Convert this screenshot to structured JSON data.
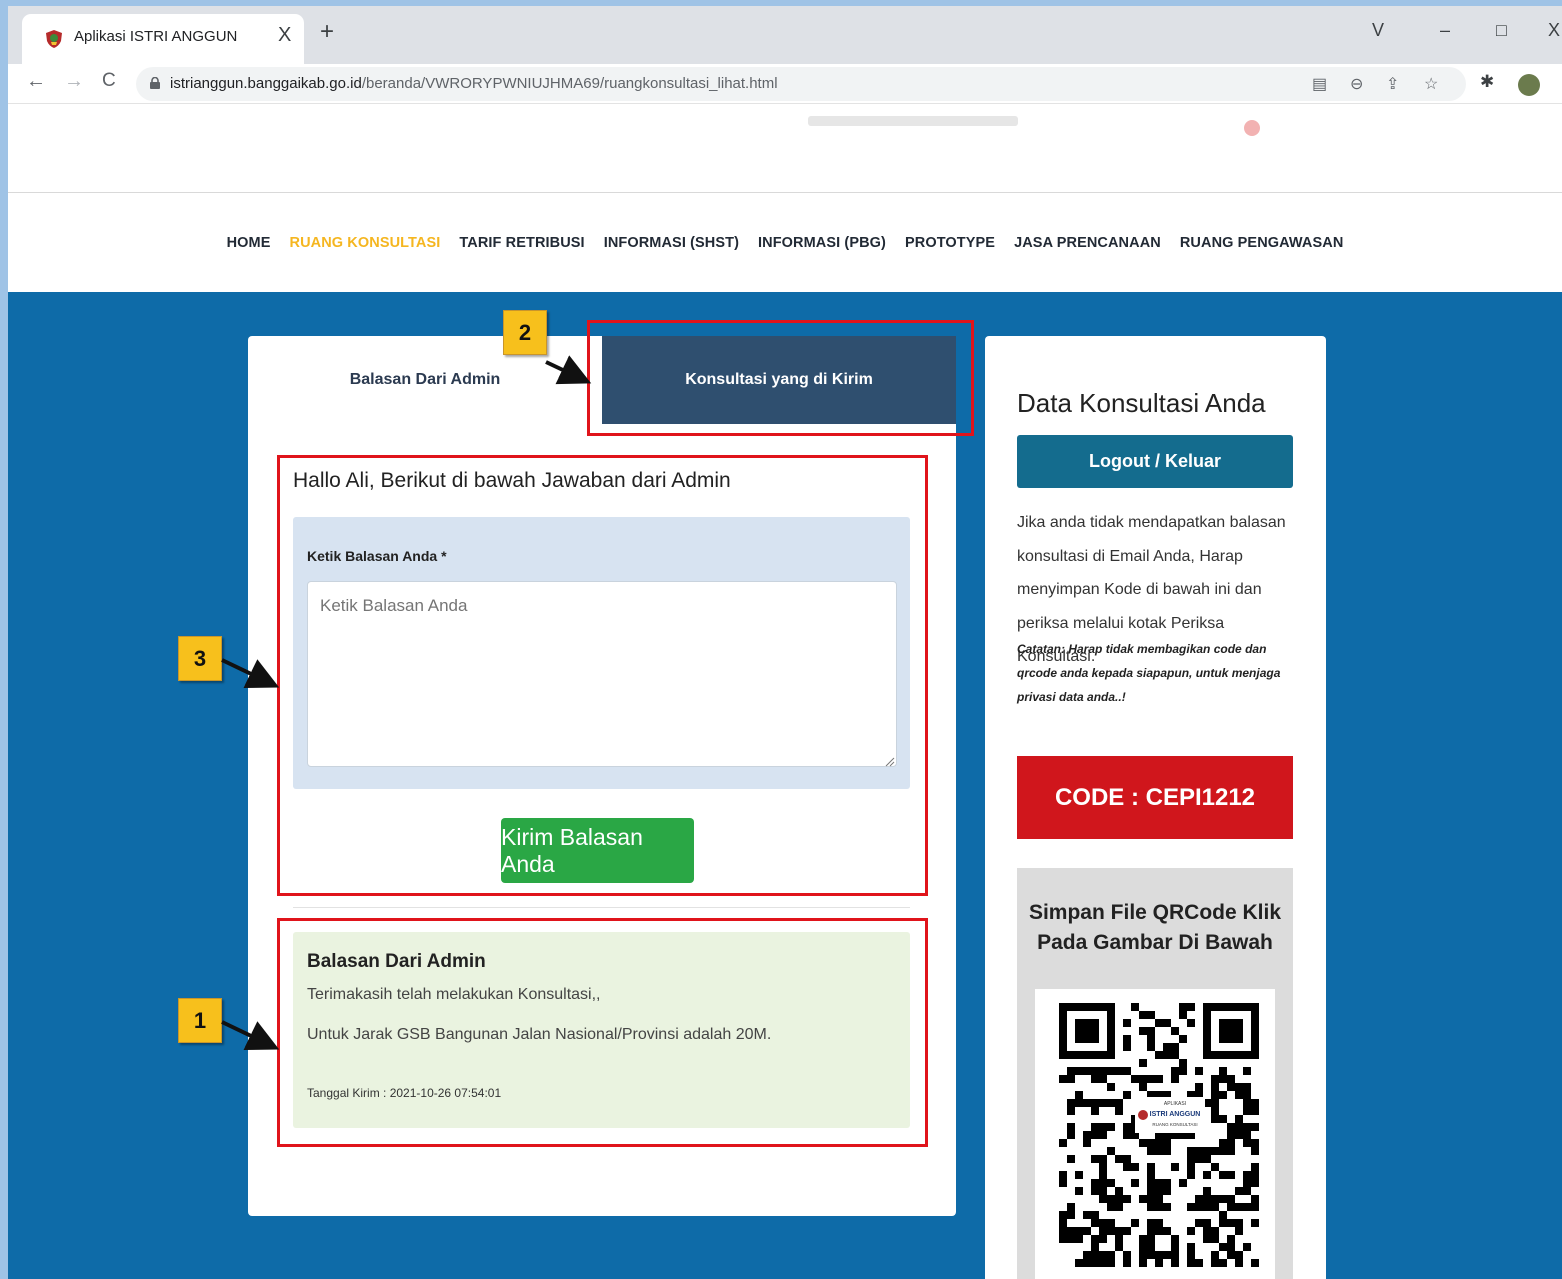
{
  "browser": {
    "tab_title": "Aplikasi ISTRI ANGGUN",
    "tab_close": "X",
    "new_tab": "+",
    "url_domain": "istrianggun.banggaikab.go.id",
    "url_path": "/beranda/VWRORYPWNIUJHMA69/ruangkonsultasi_lihat.html",
    "window_buttons": [
      "V",
      "–",
      "□",
      "X"
    ],
    "nav": {
      "back": "←",
      "forward": "→",
      "reload": "C"
    }
  },
  "site_nav": {
    "items": [
      {
        "label": "HOME",
        "active": false
      },
      {
        "label": "RUANG KONSULTASI",
        "active": true
      },
      {
        "label": "TARIF RETRIBUSI",
        "active": false
      },
      {
        "label": "INFORMASI (SHST)",
        "active": false
      },
      {
        "label": "INFORMASI (PBG)",
        "active": false
      },
      {
        "label": "PROTOTYPE",
        "active": false
      },
      {
        "label": "JASA PRENCANAAN",
        "active": false
      },
      {
        "label": "RUANG PENGAWASAN",
        "active": false
      }
    ]
  },
  "tabs": {
    "reply_tab": "Balasan Dari Admin",
    "sent_tab": "Konsultasi yang di Kirim"
  },
  "form": {
    "greeting": "Hallo Ali, Berikut di bawah Jawaban dari Admin",
    "label": "Ketik Balasan Anda *",
    "placeholder": "Ketik Balasan Anda",
    "value": "",
    "submit": "Kirim Balasan Anda"
  },
  "admin_reply": {
    "title": "Balasan Dari Admin",
    "line1": "Terimakasih telah melakukan Konsultasi,,",
    "line2": "Untuk Jarak GSB Bangunan Jalan Nasional/Provinsi adalah 20M.",
    "date": "Tanggal Kirim : 2021-10-26 07:54:01"
  },
  "sidebar": {
    "title": "Data Konsultasi Anda",
    "logout": "Logout / Keluar",
    "description": "Jika anda tidak mendapatkan balasan konsultasi di Email Anda, Harap menyimpan Kode di bawah ini dan periksa melalui kotak Periksa Konsultasi.",
    "note": "Catatan: Harap tidak membagikan code dan qrcode anda kepada siapapun, untuk menjaga privasi data anda..!",
    "code": "CODE : CEPI1212",
    "qr_heading": "Simpan File QRCode Klik Pada Gambar Di Bawah",
    "qr_logo_line1": "APLIKASI",
    "qr_logo_line2": "ISTRI ANGGUN",
    "qr_logo_line3": "RUANG KONSULTASI"
  },
  "annotations": {
    "badges": [
      "1",
      "2",
      "3"
    ]
  },
  "colors": {
    "nav_active": "#f5b620",
    "main_bg": "#0e6ba8",
    "sent_tab": "#2f4f6f",
    "send_button": "#2aa745",
    "logout_button": "#146c8e",
    "code_box": "#d0161c",
    "annotation_red": "#e0141b",
    "badge_yellow": "#f7c01c"
  }
}
